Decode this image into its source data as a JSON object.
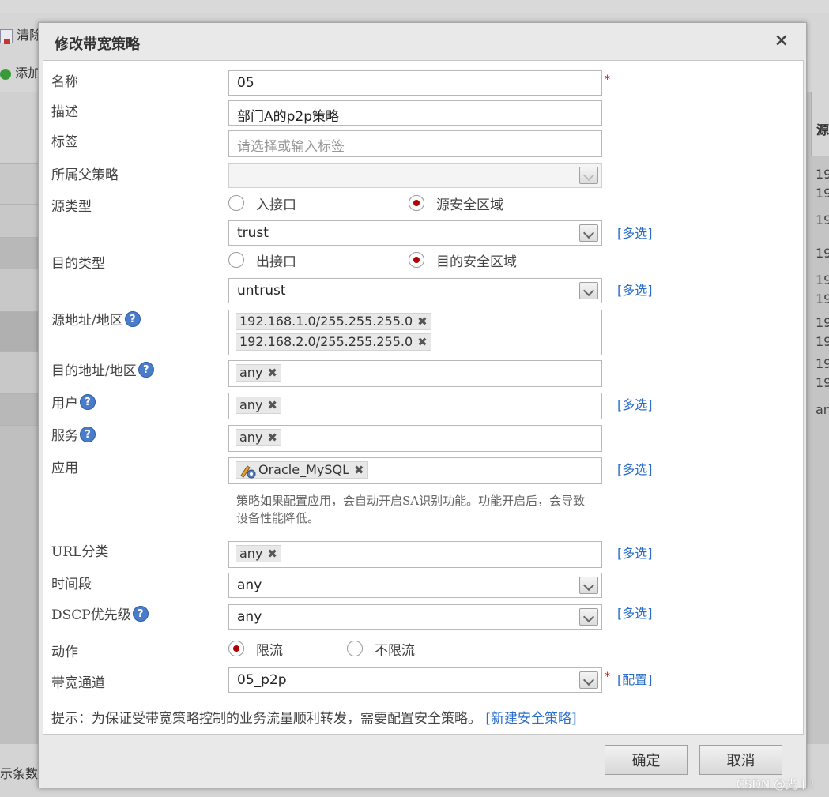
{
  "background": {
    "toolbar_clear": "清除",
    "toolbar_add": "添加",
    "right_header": "源",
    "right_cells": [
      "19",
      "19",
      "19",
      "19",
      "19",
      "19",
      "19",
      "19",
      "19",
      "19",
      "an"
    ],
    "footer_text": "示条数"
  },
  "dialog": {
    "title": "修改带宽策略",
    "close": "×",
    "fields": {
      "name": {
        "label": "名称",
        "value": "05",
        "required": "*"
      },
      "desc": {
        "label": "描述",
        "value": "部门A的p2p策略"
      },
      "tags": {
        "label": "标签",
        "placeholder": "请选择或输入标签"
      },
      "parent": {
        "label": "所属父策略",
        "value": ""
      },
      "src_type": {
        "label": "源类型",
        "option1": "入接口",
        "option2": "源安全区域",
        "selected": "源安全区域"
      },
      "src_zone": {
        "value": "trust",
        "link": "[多选]"
      },
      "dst_type": {
        "label": "目的类型",
        "option1": "出接口",
        "option2": "目的安全区域",
        "selected": "目的安全区域"
      },
      "dst_zone": {
        "value": "untrust",
        "link": "[多选]"
      },
      "src_addr": {
        "label": "源地址/地区",
        "tags": [
          "192.168.1.0/255.255.255.0",
          "192.168.2.0/255.255.255.0"
        ]
      },
      "dst_addr": {
        "label": "目的地址/地区",
        "tags": [
          "any"
        ]
      },
      "user": {
        "label": "用户",
        "tags": [
          "any"
        ],
        "link": "[多选]"
      },
      "service": {
        "label": "服务",
        "tags": [
          "any"
        ]
      },
      "app": {
        "label": "应用",
        "tags": [
          "Oracle_MySQL"
        ],
        "link": "[多选]"
      },
      "app_note": "策略如果配置应用，会自动开启SA识别功能。功能开启后，会导致设备性能降低。",
      "url": {
        "label": "URL分类",
        "tags": [
          "any"
        ],
        "link": "[多选]"
      },
      "time": {
        "label": "时间段",
        "value": "any"
      },
      "dscp": {
        "label": "DSCP优先级",
        "value": "any",
        "link": "[多选]"
      },
      "action": {
        "label": "动作",
        "option1": "限流",
        "option2": "不限流",
        "selected": "限流"
      },
      "channel": {
        "label": "带宽通道",
        "value": "05_p2p",
        "required": "*",
        "link": "[配置]"
      }
    },
    "tip_text": "提示：为保证受带宽策略控制的业务流量顺利转发，需要配置安全策略。",
    "tip_link": "[新建安全策略]",
    "help": "?",
    "tag_remove": "✖",
    "buttons": {
      "ok": "确定",
      "cancel": "取消"
    }
  },
  "watermark": "CSDN @光丨！",
  "colors": {
    "link": "#2a6ec9",
    "radio_dot": "#b00000",
    "required": "#dd0000",
    "help_icon": "#4a7cc9"
  }
}
